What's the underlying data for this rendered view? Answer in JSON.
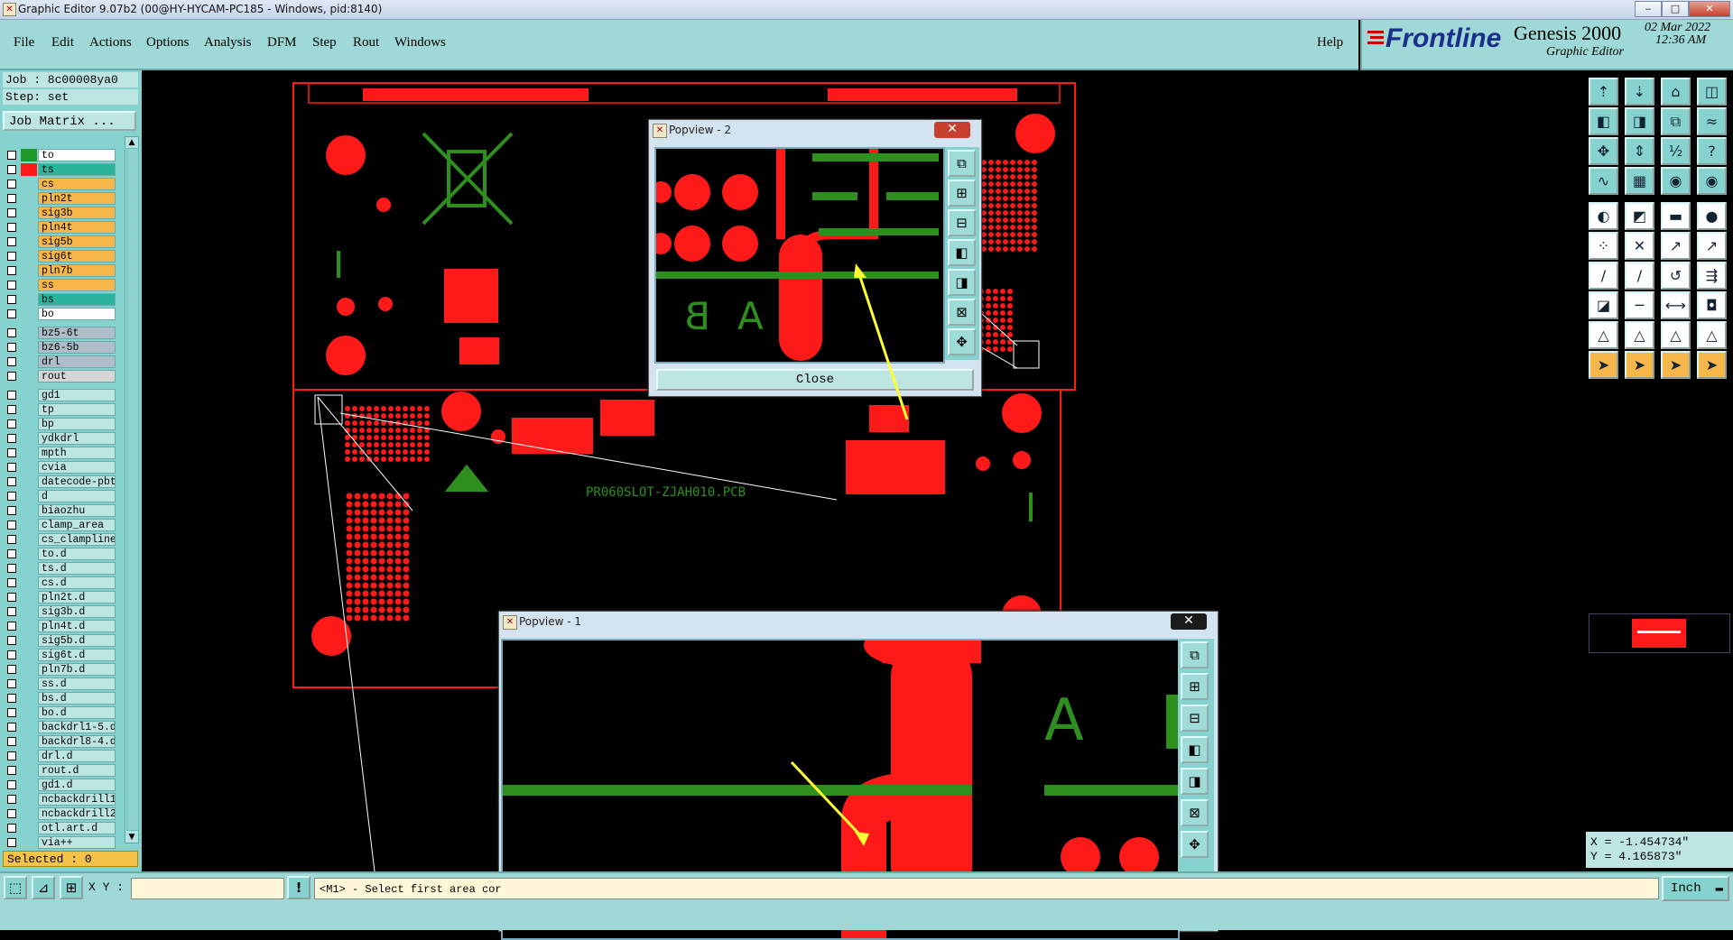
{
  "window": {
    "title": "Graphic Editor 9.07b2 (00@HY-HYCAM-PC185 - Windows, pid:8140)"
  },
  "menu": {
    "items": [
      "File",
      "Edit",
      "Actions",
      "Options",
      "Analysis",
      "DFM",
      "Step",
      "Rout",
      "Windows"
    ],
    "help": "Help"
  },
  "brand": {
    "logo": "Frontline",
    "product": "Genesis 2000",
    "subtitle": "Graphic Editor",
    "date": "02 Mar 2022",
    "time": "12:36 AM"
  },
  "job": {
    "job_line": "Job  : 8c00008ya0",
    "step_line": "Step: set",
    "job_matrix": "Job Matrix ..."
  },
  "layers": [
    {
      "name": "to",
      "color": "#ffffff",
      "ind": "#1f9a2a"
    },
    {
      "name": "ts",
      "color": "#2bb39c",
      "ind": "#ff1a1a"
    },
    {
      "name": "cs",
      "color": "#f5b74a",
      "ind": ""
    },
    {
      "name": "pln2t",
      "color": "#f5b74a",
      "ind": ""
    },
    {
      "name": "sig3b",
      "color": "#f5b74a",
      "ind": ""
    },
    {
      "name": "pln4t",
      "color": "#f5b74a",
      "ind": ""
    },
    {
      "name": "sig5b",
      "color": "#f5b74a",
      "ind": ""
    },
    {
      "name": "sig6t",
      "color": "#f5b74a",
      "ind": ""
    },
    {
      "name": "pln7b",
      "color": "#f5b74a",
      "ind": ""
    },
    {
      "name": "ss",
      "color": "#f5b74a",
      "ind": ""
    },
    {
      "name": "bs",
      "color": "#2bb39c",
      "ind": ""
    },
    {
      "name": "bo",
      "color": "#ffffff",
      "ind": ""
    },
    {
      "name": "bz5-6t",
      "color": "#aebdc8",
      "ind": ""
    },
    {
      "name": "bz6-5b",
      "color": "#aebdc8",
      "ind": ""
    },
    {
      "name": "drl",
      "color": "#aebdc8",
      "ind": ""
    },
    {
      "name": "rout",
      "color": "#d6d6d6",
      "ind": ""
    },
    {
      "name": "gd1",
      "color": "#bde6e3",
      "ind": ""
    },
    {
      "name": "tp",
      "color": "#bde6e3",
      "ind": ""
    },
    {
      "name": "bp",
      "color": "#bde6e3",
      "ind": ""
    },
    {
      "name": "ydkdrl",
      "color": "#bde6e3",
      "ind": ""
    },
    {
      "name": "mpth",
      "color": "#bde6e3",
      "ind": ""
    },
    {
      "name": "cvia",
      "color": "#bde6e3",
      "ind": ""
    },
    {
      "name": "datecode-pbt",
      "color": "#bde6e3",
      "ind": ""
    },
    {
      "name": "d",
      "color": "#bde6e3",
      "ind": ""
    },
    {
      "name": "biaozhu",
      "color": "#bde6e3",
      "ind": ""
    },
    {
      "name": "clamp_area",
      "color": "#bde6e3",
      "ind": ""
    },
    {
      "name": "cs_clampline",
      "color": "#bde6e3",
      "ind": ""
    },
    {
      "name": "to.d",
      "color": "#bde6e3",
      "ind": ""
    },
    {
      "name": "ts.d",
      "color": "#bde6e3",
      "ind": ""
    },
    {
      "name": "cs.d",
      "color": "#bde6e3",
      "ind": ""
    },
    {
      "name": "pln2t.d",
      "color": "#bde6e3",
      "ind": ""
    },
    {
      "name": "sig3b.d",
      "color": "#bde6e3",
      "ind": ""
    },
    {
      "name": "pln4t.d",
      "color": "#bde6e3",
      "ind": ""
    },
    {
      "name": "sig5b.d",
      "color": "#bde6e3",
      "ind": ""
    },
    {
      "name": "sig6t.d",
      "color": "#bde6e3",
      "ind": ""
    },
    {
      "name": "pln7b.d",
      "color": "#bde6e3",
      "ind": ""
    },
    {
      "name": "ss.d",
      "color": "#bde6e3",
      "ind": ""
    },
    {
      "name": "bs.d",
      "color": "#bde6e3",
      "ind": ""
    },
    {
      "name": "bo.d",
      "color": "#bde6e3",
      "ind": ""
    },
    {
      "name": "backdrl1-5.d",
      "color": "#bde6e3",
      "ind": ""
    },
    {
      "name": "backdrl8-4.d",
      "color": "#bde6e3",
      "ind": ""
    },
    {
      "name": "drl.d",
      "color": "#bde6e3",
      "ind": ""
    },
    {
      "name": "rout.d",
      "color": "#bde6e3",
      "ind": ""
    },
    {
      "name": "gd1.d",
      "color": "#bde6e3",
      "ind": ""
    },
    {
      "name": "ncbackdrill1",
      "color": "#bde6e3",
      "ind": ""
    },
    {
      "name": "ncbackdrill2",
      "color": "#bde6e3",
      "ind": ""
    },
    {
      "name": "otl.art.d",
      "color": "#bde6e3",
      "ind": ""
    },
    {
      "name": "via++",
      "color": "#bde6e3",
      "ind": ""
    }
  ],
  "selected": "Selected : 0",
  "bottom": {
    "xy_label": "X Y :",
    "xy_value": "",
    "prompt": "<M1> - Select first area cor",
    "unit": "Inch"
  },
  "coords": {
    "x": "X = -1.454734\"",
    "y": "Y = 4.165873\""
  },
  "board": {
    "pcb_text": "PR060SLOT-ZJAH010.PCB"
  },
  "popups": {
    "popview2": {
      "title": "Popview - 2",
      "close": "Close"
    },
    "popview1": {
      "title": "Popview - 1"
    }
  }
}
